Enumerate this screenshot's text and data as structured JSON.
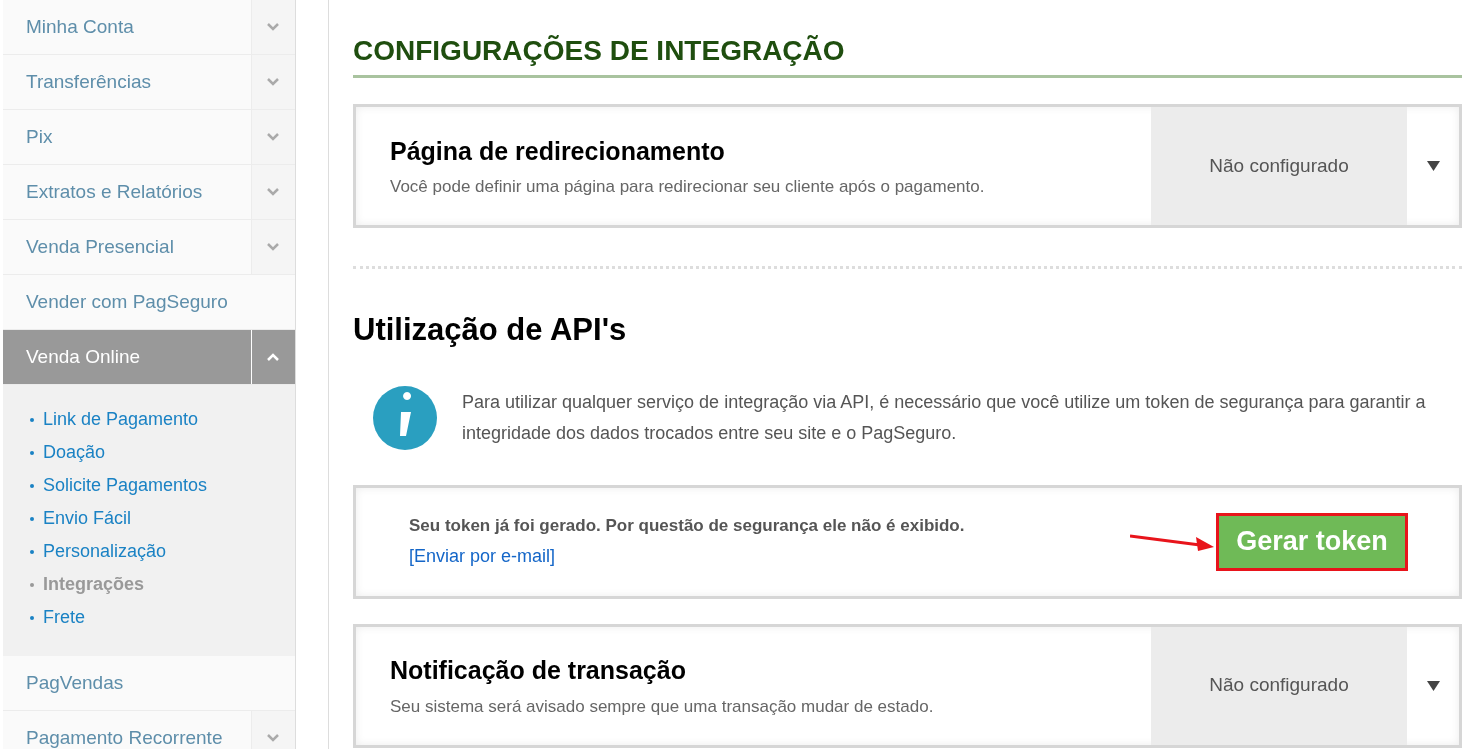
{
  "sidebar": {
    "items": [
      {
        "label": "Minha Conta",
        "kind": "group",
        "expanded": false,
        "selected": false
      },
      {
        "label": "Transferências",
        "kind": "group",
        "expanded": false,
        "selected": false
      },
      {
        "label": "Pix",
        "kind": "group",
        "expanded": false,
        "selected": false
      },
      {
        "label": "Extratos e Relatórios",
        "kind": "group",
        "expanded": false,
        "selected": false
      },
      {
        "label": "Venda Presencial",
        "kind": "group",
        "expanded": false,
        "selected": false
      },
      {
        "label": "Vender com PagSeguro",
        "kind": "link",
        "selected": false
      },
      {
        "label": "Venda Online",
        "kind": "group",
        "expanded": true,
        "selected": true,
        "children": [
          {
            "label": "Link de Pagamento",
            "selected": false
          },
          {
            "label": "Doação",
            "selected": false
          },
          {
            "label": "Solicite Pagamentos",
            "selected": false
          },
          {
            "label": "Envio Fácil",
            "selected": false
          },
          {
            "label": "Personalização",
            "selected": false
          },
          {
            "label": "Integrações",
            "selected": true
          },
          {
            "label": "Frete",
            "selected": false
          }
        ]
      },
      {
        "label": "PagVendas",
        "kind": "link",
        "selected": false
      },
      {
        "label": "Pagamento Recorrente",
        "kind": "group",
        "expanded": false,
        "selected": false
      }
    ]
  },
  "page_title": "CONFIGURAÇÕES DE INTEGRAÇÃO",
  "redirect_card": {
    "title": "Página de redirecionamento",
    "description": "Você pode definir uma página para redirecionar seu cliente após o pagamento.",
    "status": "Não configurado"
  },
  "api_section": {
    "title": "Utilização de API's",
    "info": "Para utilizar qualquer serviço de integração via API, é necessário que você utilize um token de segurança para garantir a integridade dos dados trocados entre seu site e o PagSeguro.",
    "token_message": "Seu token já foi gerado. Por questão de segurança ele não é exibido.",
    "email_link": "[Enviar por e-mail]",
    "button": {
      "label": "Gerar token",
      "highlighted": true
    }
  },
  "notification_card": {
    "title": "Notificação de transação",
    "description": "Seu sistema será avisado sempre que uma transação mudar de estado.",
    "status": "Não configurado"
  }
}
